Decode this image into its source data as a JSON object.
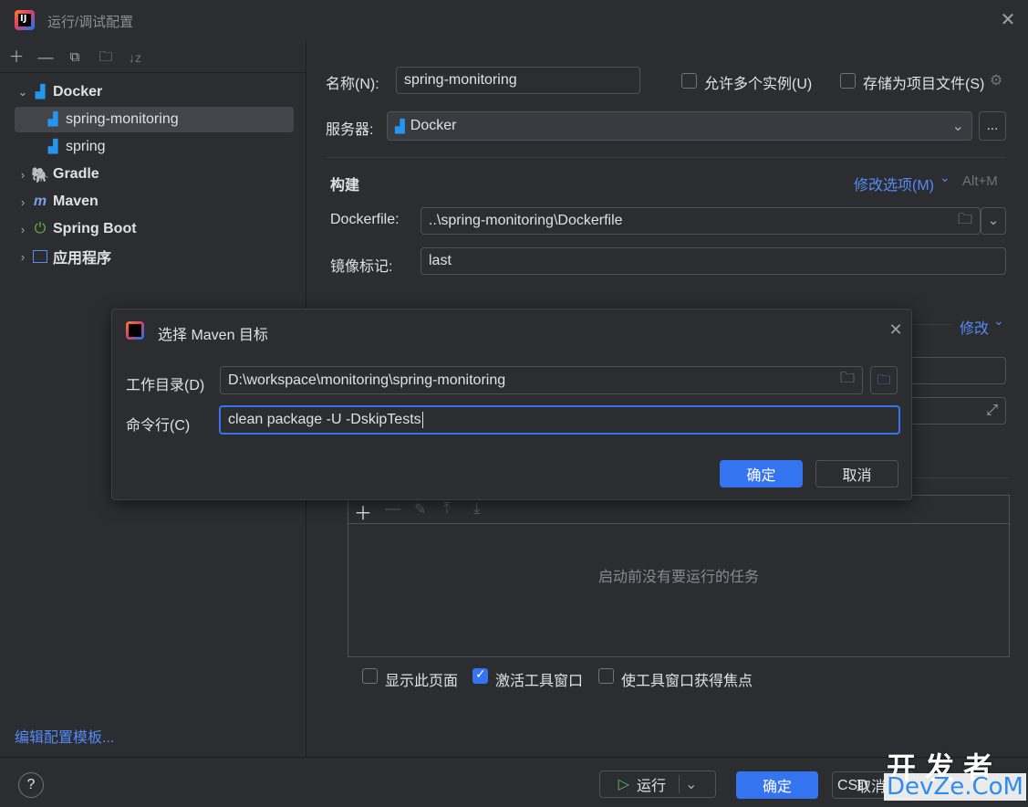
{
  "window": {
    "title": "运行/调试配置"
  },
  "sidebar": {
    "items": [
      {
        "label": "Docker",
        "expanded": true
      },
      {
        "label": "spring-monitoring",
        "selected": true
      },
      {
        "label": "spring"
      },
      {
        "label": "Gradle"
      },
      {
        "label": "Maven"
      },
      {
        "label": "Spring Boot"
      },
      {
        "label": "应用程序"
      }
    ],
    "edit_templates": "编辑配置模板..."
  },
  "form": {
    "name_label": "名称(N):",
    "name_value": "spring-monitoring",
    "allow_multiple": "允许多个实例(U)",
    "store_as_file": "存储为项目文件(S)",
    "server_label": "服务器:",
    "server_value": "Docker",
    "more_btn": "...",
    "build_title": "构建",
    "modify_options": "修改选项(M)",
    "modify_shortcut": "Alt+M",
    "dockerfile_label": "Dockerfile:",
    "dockerfile_value": "..\\spring-monitoring\\Dockerfile",
    "image_tag_label": "镜像标记:",
    "image_tag_value": "last",
    "modify_link": "修改",
    "no_tasks": "启动前没有要运行的任务",
    "show_page": "显示此页面",
    "activate_tool": "激活工具窗口",
    "focus_tool": "使工具窗口获得焦点"
  },
  "dialog": {
    "title": "选择 Maven 目标",
    "workdir_label": "工作目录(D)",
    "workdir_value": "D:\\workspace\\monitoring\\spring-monitoring",
    "cmd_label": "命令行(C)",
    "cmd_value": "clean package -U -DskipTests",
    "ok": "确定",
    "cancel": "取消"
  },
  "footer": {
    "help": "?",
    "run": "运行",
    "ok": "确定",
    "cancel": "取消"
  },
  "watermark": {
    "top": "开发者",
    "bottom": "DevZe.CoM",
    "partial": "CSD"
  },
  "colors": {
    "accent": "#3574f0",
    "link": "#548af7",
    "background": "#2b2d30"
  }
}
